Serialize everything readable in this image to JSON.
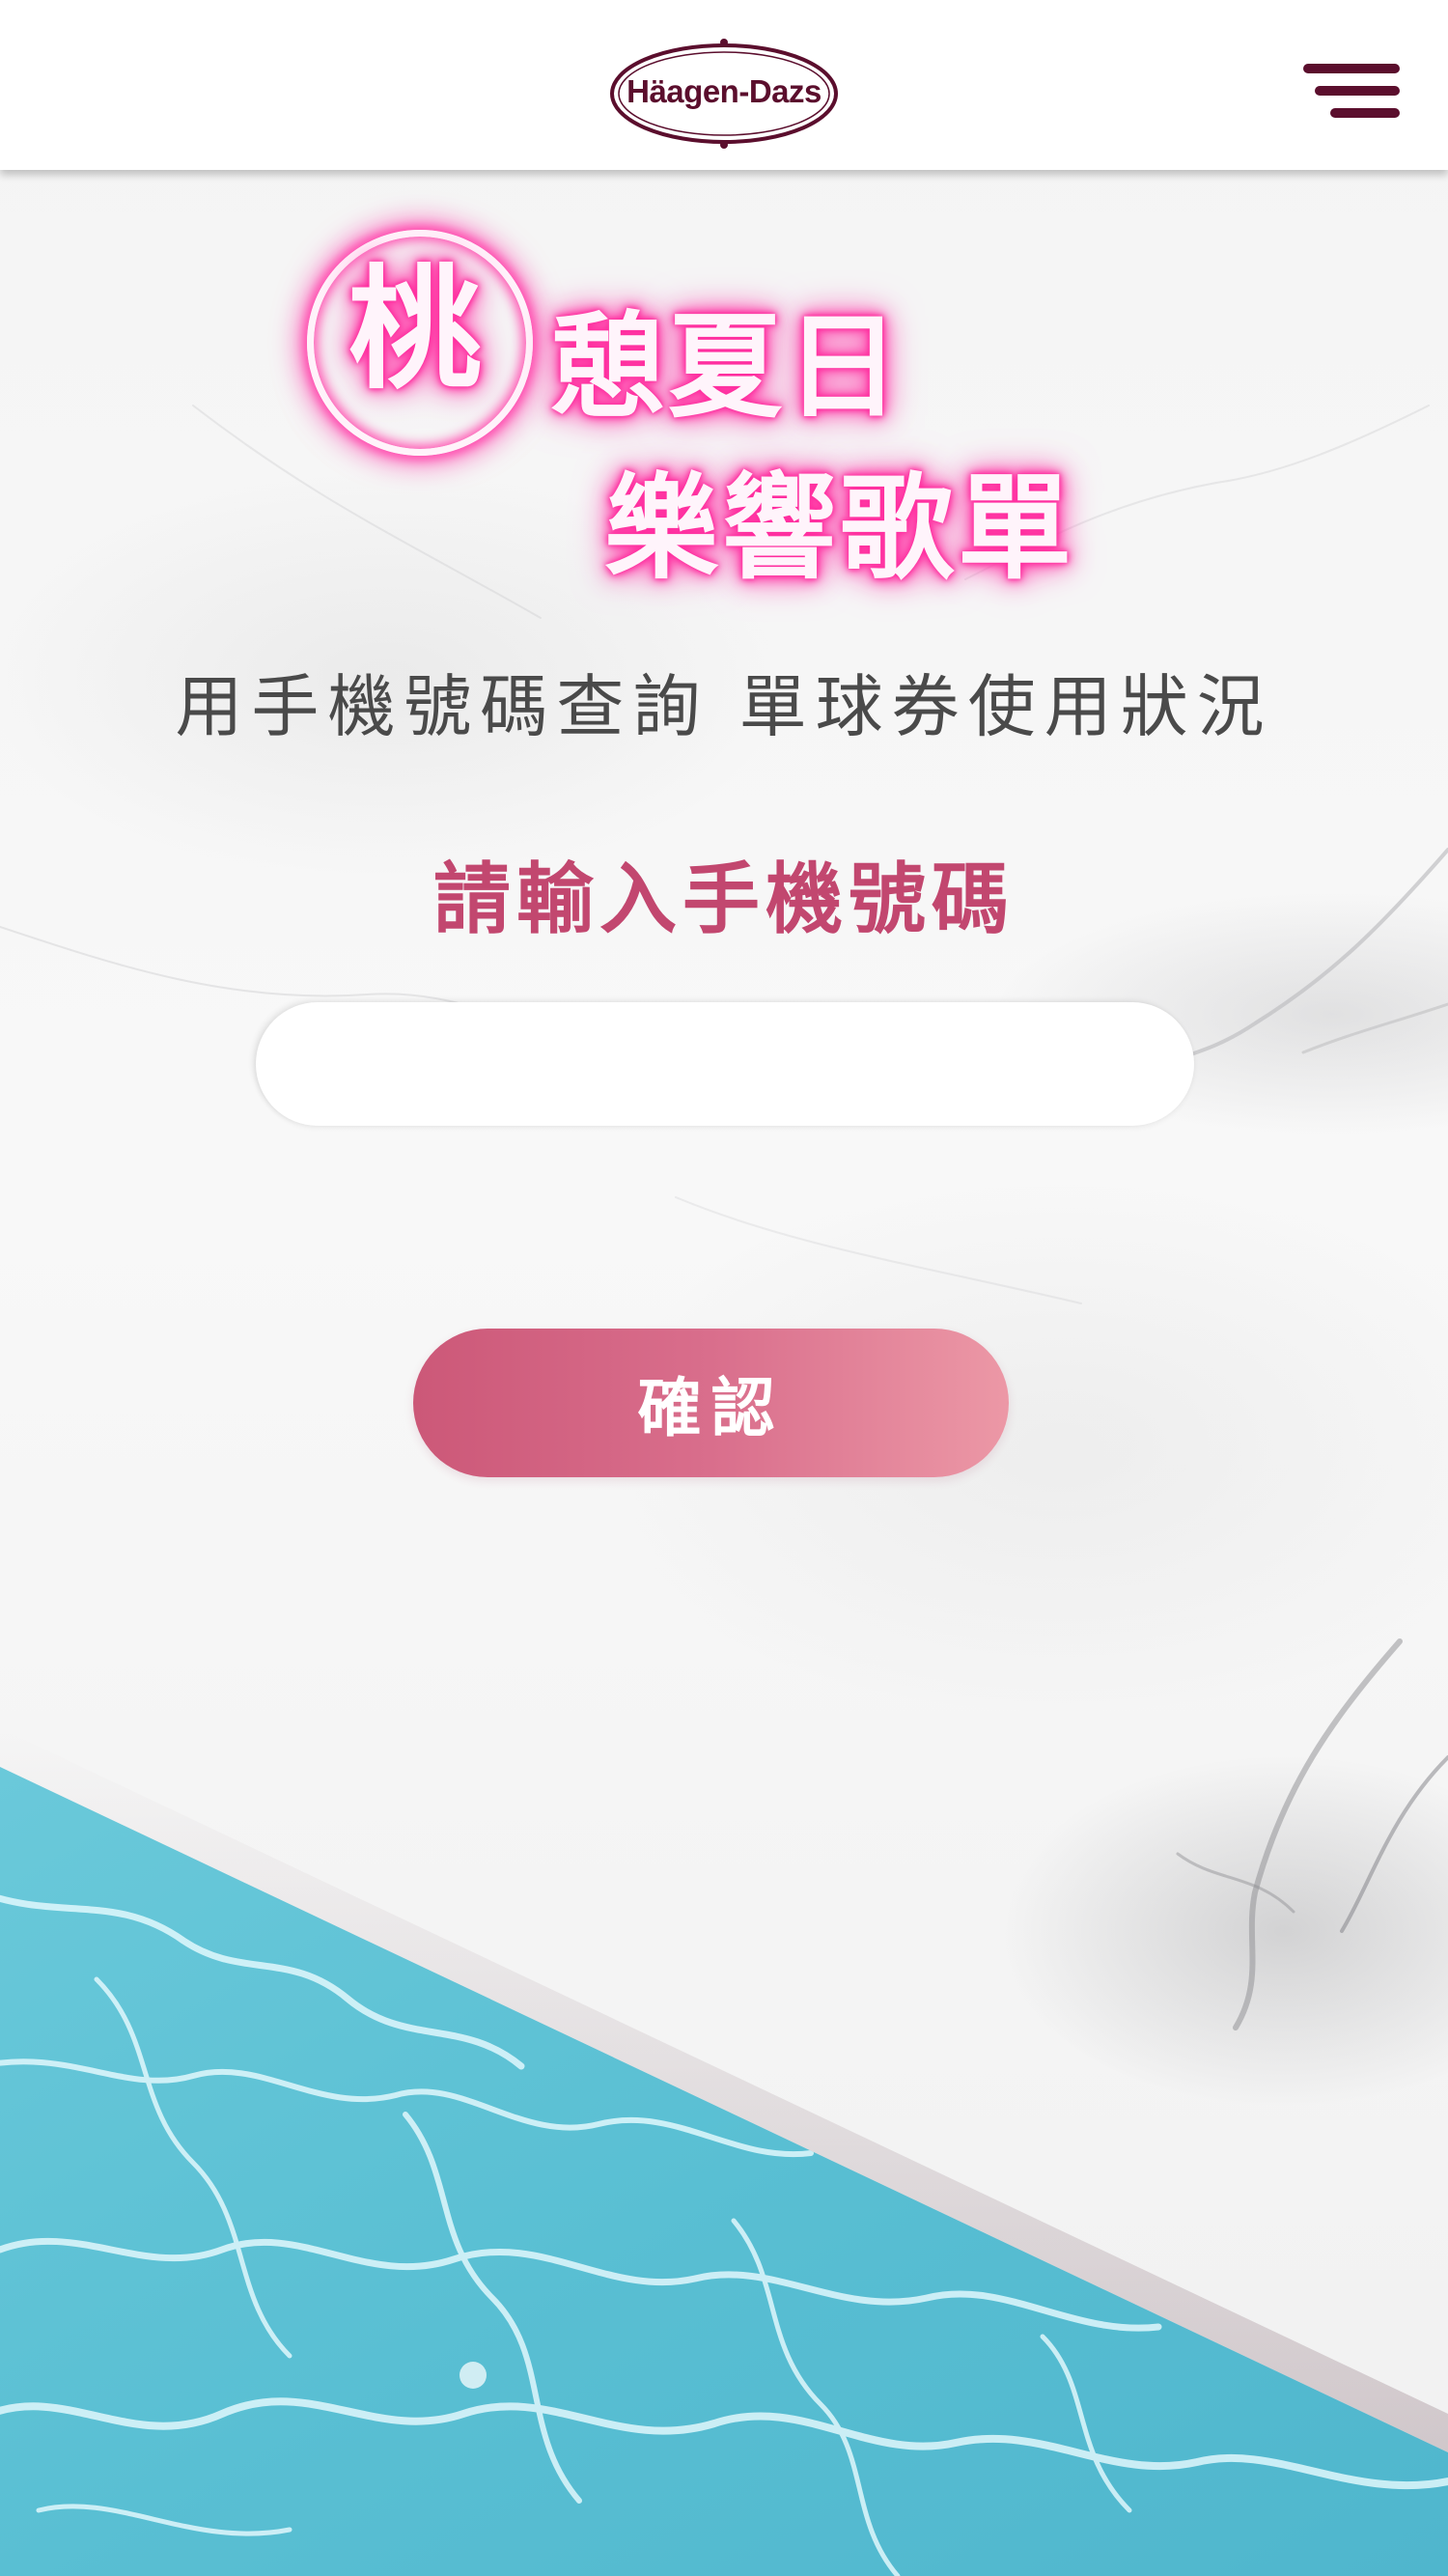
{
  "header": {
    "logo_text": "Häagen-Dazs",
    "menu_icon": "hamburger-menu-icon"
  },
  "campaign": {
    "title_char": "桃",
    "title_line1": "憩夏日",
    "title_line2": "樂響歌單"
  },
  "form": {
    "subtitle": "用手機號碼查詢 單球券使用狀況",
    "phone_label": "請輸入手機號碼",
    "phone_value": "",
    "phone_placeholder": "",
    "confirm_label": "確認"
  },
  "colors": {
    "brand": "#5b0e2d",
    "accent": "#c2476f",
    "button_start": "#cc5878",
    "button_end": "#ec98a6",
    "neon": "#ff2e9f",
    "water": "#5ec3d6"
  }
}
